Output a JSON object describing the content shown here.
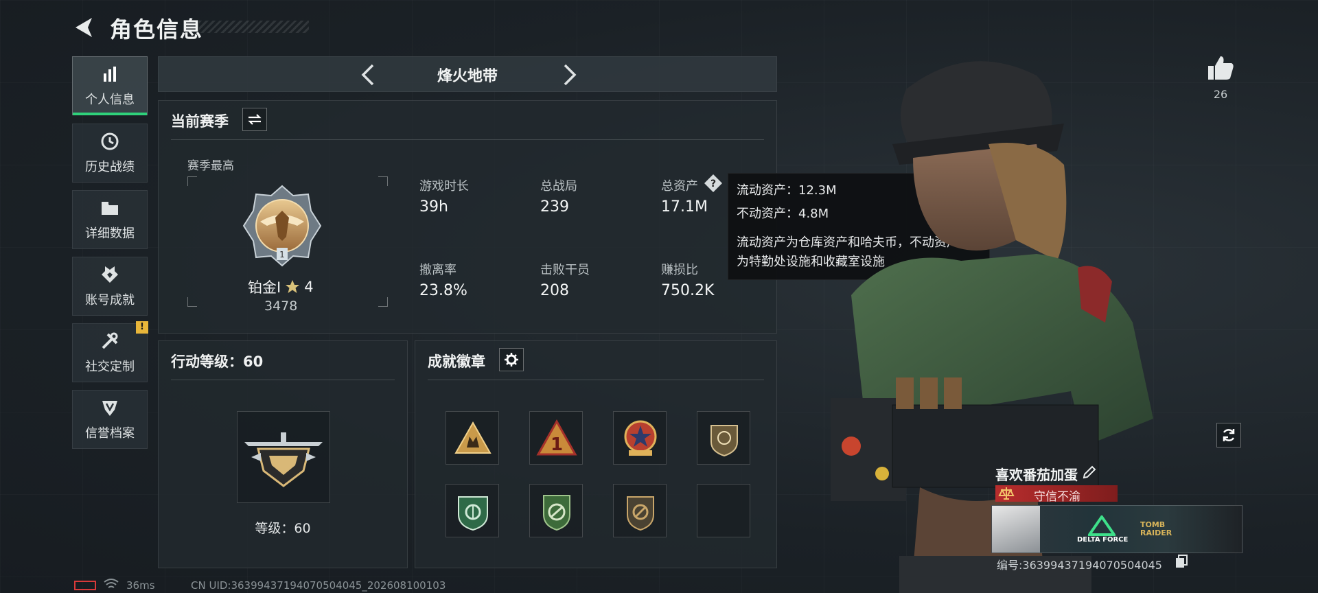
{
  "header": {
    "title": "角色信息"
  },
  "sidebar": {
    "items": [
      {
        "label": "个人信息",
        "icon": "bar-chart-icon"
      },
      {
        "label": "历史战绩",
        "icon": "history-clock-icon"
      },
      {
        "label": "详细数据",
        "icon": "folder-icon"
      },
      {
        "label": "账号成就",
        "icon": "achievement-icon"
      },
      {
        "label": "社交定制",
        "icon": "tools-icon",
        "badge": "!"
      },
      {
        "label": "信誉档案",
        "icon": "shield-icon"
      }
    ]
  },
  "mode": {
    "title": "烽火地带"
  },
  "season": {
    "title": "当前赛季",
    "best_label": "赛季最高",
    "rank_name": "铂金Ⅰ",
    "rank_stars": "4",
    "rank_score": "3478",
    "stats": [
      {
        "label": "游戏时长",
        "value": "39h"
      },
      {
        "label": "总战局",
        "value": "239"
      },
      {
        "label": "总资产",
        "value": "17.1M"
      },
      {
        "label": "撤离率",
        "value": "23.8%"
      },
      {
        "label": "击败干员",
        "value": "208"
      },
      {
        "label": "赚损比",
        "value": "750.2K"
      }
    ]
  },
  "tooltip": {
    "line1": "流动资产：12.3M",
    "line2": "不动资产：4.8M",
    "desc1": "流动资产为仓库资产和哈夫币，不动资产",
    "desc2": "为特勤处设施和收藏室设施"
  },
  "action_level": {
    "title": "行动等级：60",
    "level_text": "等级：60"
  },
  "achievements": {
    "title": "成就徽章",
    "badges": [
      "triangle-squad-badge",
      "number-one-badge",
      "star-emblem-badge",
      "skull-shield-badge",
      "green-shield-badge",
      "green-crest-badge",
      "bronze-shield-badge",
      "empty-slot"
    ]
  },
  "profile": {
    "likes": "26",
    "name": "喜欢番茄加蛋",
    "honor": "守信不渝",
    "banner_logo1": "DELTA FORCE",
    "banner_logo2": "TOMB RAIDER",
    "id_text": "编号:3639943719407050404​5"
  },
  "status_bar": {
    "ping": "36ms",
    "uid": "CN UID:36399437194070504045_202608100103"
  },
  "colors": {
    "accent_green": "#2fd27b",
    "honor_red": "#b82d2d",
    "warn_yellow": "#e8b63a"
  }
}
